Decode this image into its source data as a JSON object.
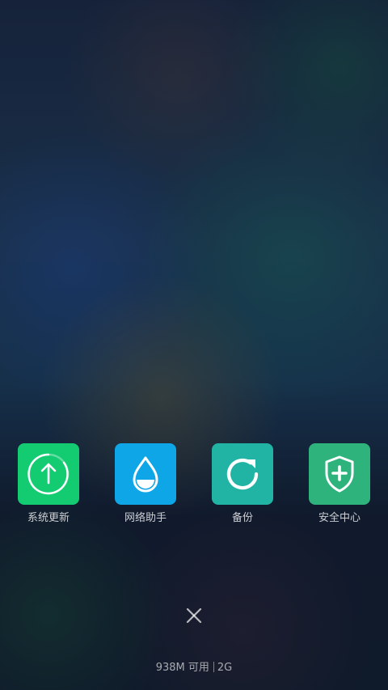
{
  "apps": [
    {
      "id": "system-update",
      "label": "系统更新",
      "color": "#13cc72",
      "icon": "upload-arrow-icon"
    },
    {
      "id": "network-assistant",
      "label": "网络助手",
      "color": "#0ea6e6",
      "icon": "water-drop-icon"
    },
    {
      "id": "backup",
      "label": "备份",
      "color": "#21b4a4",
      "icon": "refresh-icon"
    },
    {
      "id": "security-center",
      "label": "安全中心",
      "color": "#2fb37d",
      "icon": "shield-plus-icon"
    }
  ],
  "close": {
    "icon": "close-icon"
  },
  "status": {
    "memory": "938M 可用",
    "network": "2G"
  }
}
